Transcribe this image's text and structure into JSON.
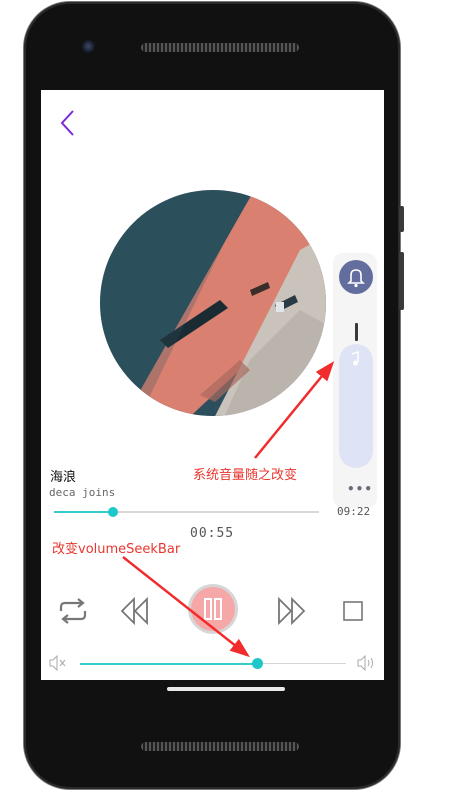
{
  "song": {
    "title": "海浪",
    "artist": "deca joins"
  },
  "playback": {
    "current_time": "00:55",
    "total_time": "09:22",
    "progress_fraction": 0.223
  },
  "volume": {
    "seekbar_fraction": 0.665
  },
  "annotations": {
    "system_volume_note": "系统音量随之改变",
    "seekbar_note": "改变volumeSeekBar"
  },
  "icons": {
    "back": "chevron-left-icon",
    "bell": "bell-icon",
    "music_note": "music-note-icon",
    "more": "more-dots-icon",
    "repeat": "repeat-icon",
    "previous": "rewind-icon",
    "pause": "pause-icon",
    "next": "fast-forward-icon",
    "stop": "stop-icon",
    "volume_mute": "volume-mute-icon",
    "volume_up": "volume-up-icon"
  },
  "colors": {
    "accent": "#1ec8c8",
    "back_arrow": "#7a2ad8",
    "annotation": "#e8372f",
    "play_button": "#f6a8a8",
    "volume_panel_track": "#dfe3f6",
    "bell_button": "#636e9e"
  }
}
